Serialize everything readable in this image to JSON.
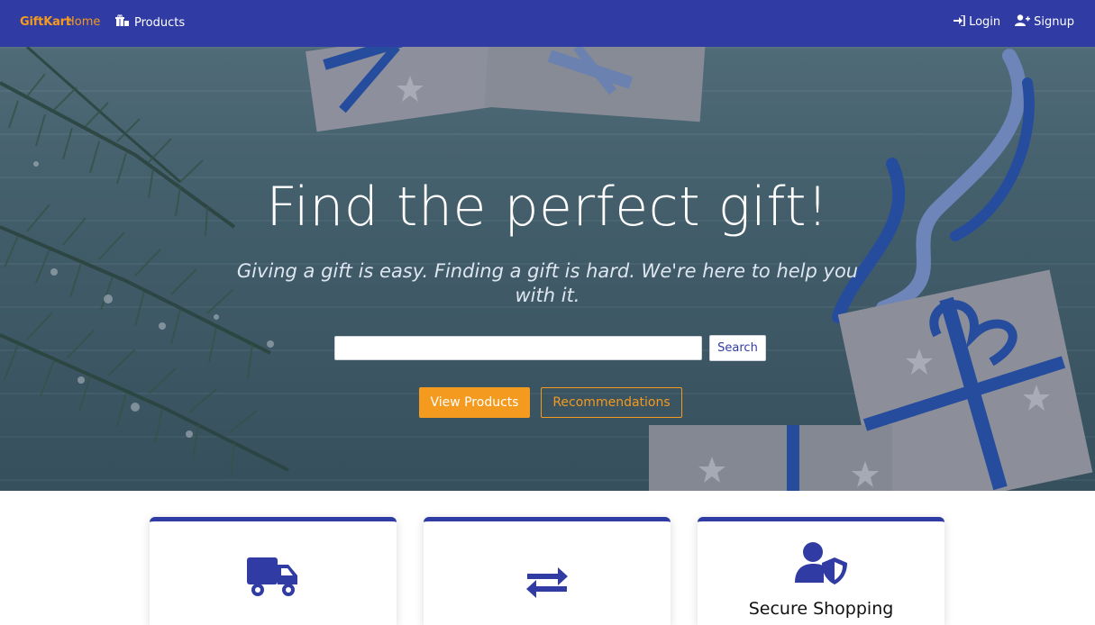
{
  "nav": {
    "brand": "GiftKart",
    "home": "Home",
    "products": "Products",
    "login": "Login",
    "signup": "Signup"
  },
  "hero": {
    "title": "Find the perfect gift!",
    "subtitle": "Giving a gift is easy. Finding a gift is hard. We're here to help you with it.",
    "search_value": "",
    "search_button": "Search",
    "view_products": "View Products",
    "recommendations": "Recommendations"
  },
  "features": [
    {
      "icon": "truck-icon",
      "title": ""
    },
    {
      "icon": "exchange-icon",
      "title": ""
    },
    {
      "icon": "user-shield-icon",
      "title": "Secure Shopping"
    }
  ],
  "colors": {
    "primary": "#303ca3",
    "accent": "#f49a1e",
    "white": "#ffffff"
  }
}
